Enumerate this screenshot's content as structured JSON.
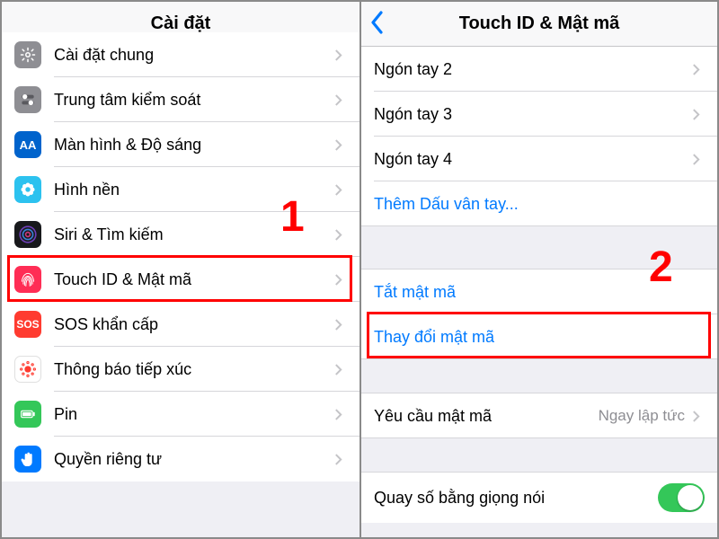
{
  "left": {
    "title": "Cài đặt",
    "rows": [
      {
        "label": "Cài đặt chung"
      },
      {
        "label": "Trung tâm kiểm soát"
      },
      {
        "label": "Màn hình & Độ sáng"
      },
      {
        "label": "Hình nền"
      },
      {
        "label": "Siri & Tìm kiếm"
      },
      {
        "label": "Touch ID & Mật mã"
      },
      {
        "label": "SOS khẩn cấp"
      },
      {
        "label": "Thông báo tiếp xúc"
      },
      {
        "label": "Pin"
      },
      {
        "label": "Quyền riêng tư"
      }
    ],
    "icon_text": {
      "display": "AA",
      "sos": "SOS"
    },
    "annotation": "1"
  },
  "right": {
    "title": "Touch ID & Mật mã",
    "fingers": [
      {
        "label": "Ngón tay 2"
      },
      {
        "label": "Ngón tay 3"
      },
      {
        "label": "Ngón tay 4"
      }
    ],
    "add_fingerprint": "Thêm Dấu vân tay...",
    "turn_off": "Tắt mật mã",
    "change": "Thay đổi mật mã",
    "require_label": "Yêu cầu mật mã",
    "require_value": "Ngay lập tức",
    "voice_dial": "Quay số bằng giọng nói",
    "annotation": "2"
  }
}
